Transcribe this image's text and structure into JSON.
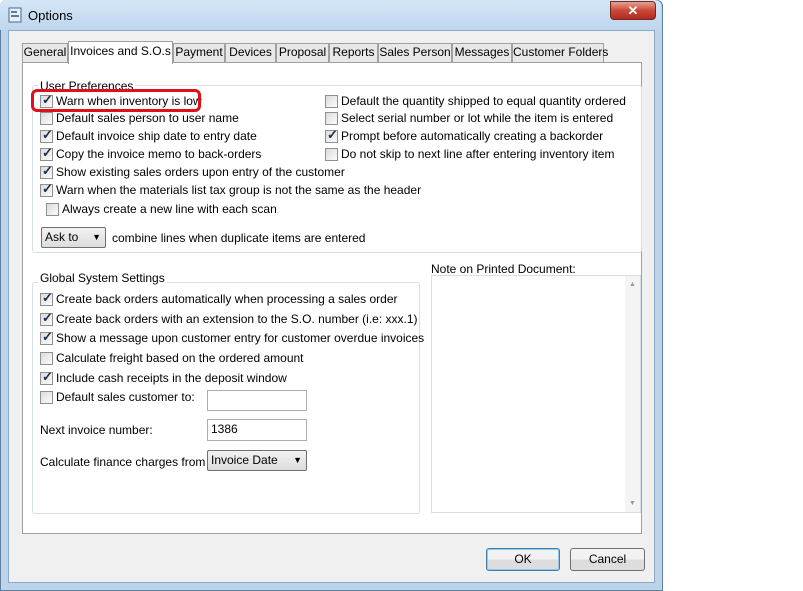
{
  "window": {
    "title": "Options",
    "close_glyph": "✕"
  },
  "tabs": [
    {
      "label": "General"
    },
    {
      "label": "Invoices and S.O.s"
    },
    {
      "label": "Payment"
    },
    {
      "label": "Devices"
    },
    {
      "label": "Proposal"
    },
    {
      "label": "Reports"
    },
    {
      "label": "Sales Person"
    },
    {
      "label": "Messages"
    },
    {
      "label": "Customer Folders"
    }
  ],
  "user_preferences": {
    "title": "User Preferences",
    "left": [
      {
        "label": "Warn when inventory is low",
        "checked": true
      },
      {
        "label": "Default sales person to user name",
        "checked": false
      },
      {
        "label": "Default invoice ship date to entry date",
        "checked": true
      },
      {
        "label": "Copy the invoice memo to back-orders",
        "checked": true
      },
      {
        "label": "Show existing sales orders upon entry of the customer",
        "checked": true
      },
      {
        "label": "Warn when the materials list tax group is not the same as the header",
        "checked": true
      }
    ],
    "always_new_line": {
      "label": "Always create a new line with each scan",
      "checked": false
    },
    "right": [
      {
        "label": "Default the quantity shipped to equal quantity ordered",
        "checked": false
      },
      {
        "label": "Select serial number or lot while the item is entered",
        "checked": false
      },
      {
        "label": "Prompt before automatically creating a backorder",
        "checked": true
      },
      {
        "label": "Do not skip to next line after entering inventory item",
        "checked": false
      }
    ],
    "combine": {
      "value": "Ask to",
      "label": "combine lines when duplicate items are entered"
    }
  },
  "global_settings": {
    "title": "Global System Settings",
    "items": [
      {
        "label": "Create back orders automatically when processing a sales order",
        "checked": true
      },
      {
        "label": "Create back orders with an extension to the S.O. number (i.e: xxx.1)",
        "checked": true
      },
      {
        "label": "Show a message upon customer entry for customer overdue invoices",
        "checked": true
      },
      {
        "label": "Calculate freight based on the ordered amount",
        "checked": false
      },
      {
        "label": "Include cash receipts in the deposit window",
        "checked": true
      }
    ],
    "default_customer": {
      "label": "Default sales customer to:",
      "checked": false,
      "value": ""
    },
    "next_invoice": {
      "label": "Next invoice number:",
      "value": "1386"
    },
    "finance": {
      "label": "Calculate finance charges from the",
      "value": "Invoice Date"
    }
  },
  "note": {
    "label": "Note on Printed Document:"
  },
  "buttons": {
    "ok": "OK",
    "cancel": "Cancel"
  },
  "colors": {
    "highlight": "#e0101a",
    "window_frame": "#bcd3ea",
    "close": "#c9483a"
  }
}
